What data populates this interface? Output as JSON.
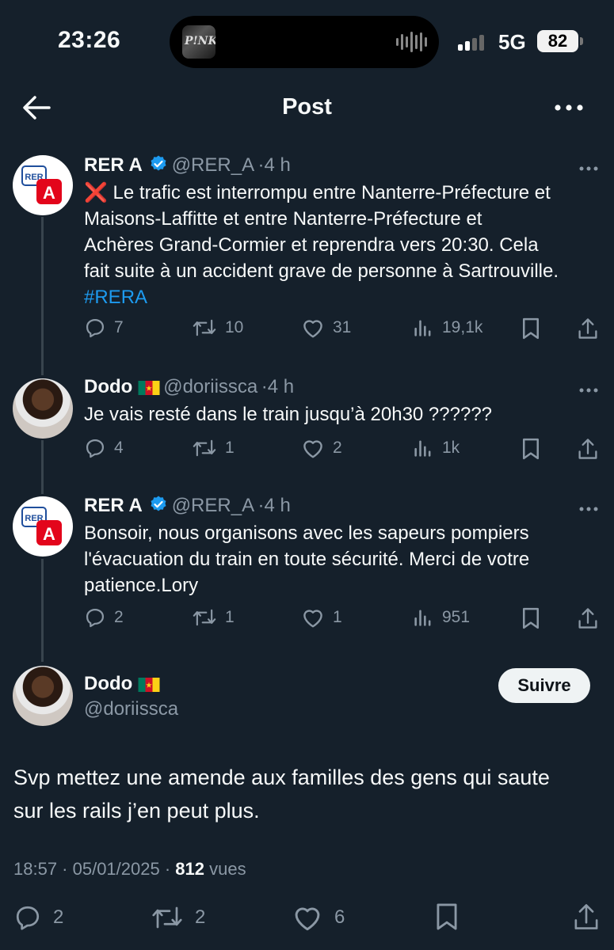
{
  "status_bar": {
    "time": "23:26",
    "album_text": "P!NK",
    "network": "5G",
    "battery": "82"
  },
  "header": {
    "title": "Post"
  },
  "thread": [
    {
      "name": "RER A",
      "handle": "@RER_A",
      "age": "4 h",
      "verified": true,
      "text_lines": [
        "❌ Le trafic est interrompu entre Nanterre-Préfecture et",
        "Maisons-Laffitte et entre Nanterre-Préfecture et",
        "Achères Grand-Cormier et reprendra vers 20:30. Cela",
        "fait suite à un accident grave de personne à Sartrouville."
      ],
      "hashtag": "#RERA",
      "replies": "7",
      "reposts": "10",
      "likes": "31",
      "views": "19,1k"
    },
    {
      "name": "Dodo",
      "handle": "@doriissca",
      "age": "4 h",
      "text_lines": [
        "Je vais resté dans le train jusqu’à 20h30 ??????"
      ],
      "replies": "4",
      "reposts": "1",
      "likes": "2",
      "views": "1k"
    },
    {
      "name": "RER A",
      "handle": "@RER_A",
      "age": "4 h",
      "verified": true,
      "text_lines": [
        "Bonsoir, nous organisons avec les sapeurs pompiers",
        "l'évacuation du train en toute sécurité. Merci de votre",
        "patience.Lory"
      ],
      "replies": "2",
      "reposts": "1",
      "likes": "1",
      "views": "951"
    }
  ],
  "main_post": {
    "name": "Dodo",
    "handle": "@doriissca",
    "follow_label": "Suivre",
    "text_lines": [
      "Svp mettez une amende aux familles des gens qui saute",
      "sur les rails j’en peut plus."
    ],
    "timestamp": "18:57 · 05/01/2025 ·",
    "views_count": "812",
    "views_label": "vues",
    "replies": "2",
    "reposts": "2",
    "likes": "6"
  },
  "avatars": {
    "rer_logo_top": "RER",
    "rer_logo_letter": "A"
  },
  "colors": {
    "background": "#15202b",
    "accent": "#1d9bf0",
    "muted": "#8b98a5",
    "rer_red": "#e3051b"
  }
}
